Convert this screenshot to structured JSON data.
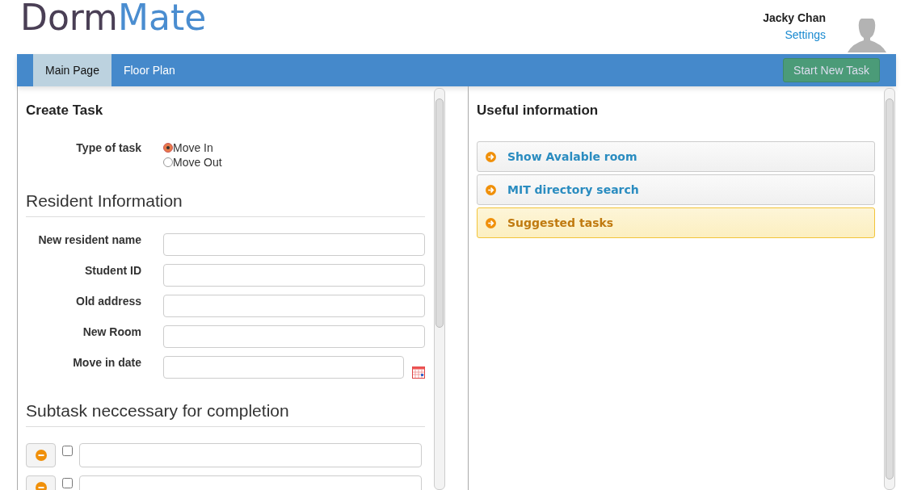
{
  "logo": {
    "part_1": "Dorm",
    "part_2": "Mate"
  },
  "user": {
    "name": "Jacky Chan",
    "settings_link": "Settings"
  },
  "nav": {
    "tabs": [
      {
        "label": "Main Page",
        "selected": true
      },
      {
        "label": "Floor Plan",
        "selected": false
      }
    ],
    "action_button": "Start New Task"
  },
  "create_task": {
    "title": "Create Task",
    "type_label": "Type of task",
    "options": [
      {
        "label": "Move In",
        "selected": true
      },
      {
        "label": "Move Out",
        "selected": false
      }
    ]
  },
  "resident_info": {
    "title": "Resident Information",
    "fields": [
      {
        "label": "New resident name",
        "kind": "text"
      },
      {
        "label": "Student ID",
        "kind": "text"
      },
      {
        "label": "Old address",
        "kind": "text"
      },
      {
        "label": "New Room",
        "kind": "text"
      },
      {
        "label": "Move in date",
        "kind": "date"
      }
    ]
  },
  "subtasks": {
    "title": "Subtask neccessary for completion",
    "rows": [
      {
        "checked": false
      },
      {
        "checked": false
      }
    ]
  },
  "useful_info": {
    "title": "Useful information",
    "items": [
      {
        "label": "Show Avalable room",
        "selected": false
      },
      {
        "label": "MIT directory search",
        "selected": false
      },
      {
        "label": "Suggested tasks",
        "selected": true
      }
    ]
  }
}
